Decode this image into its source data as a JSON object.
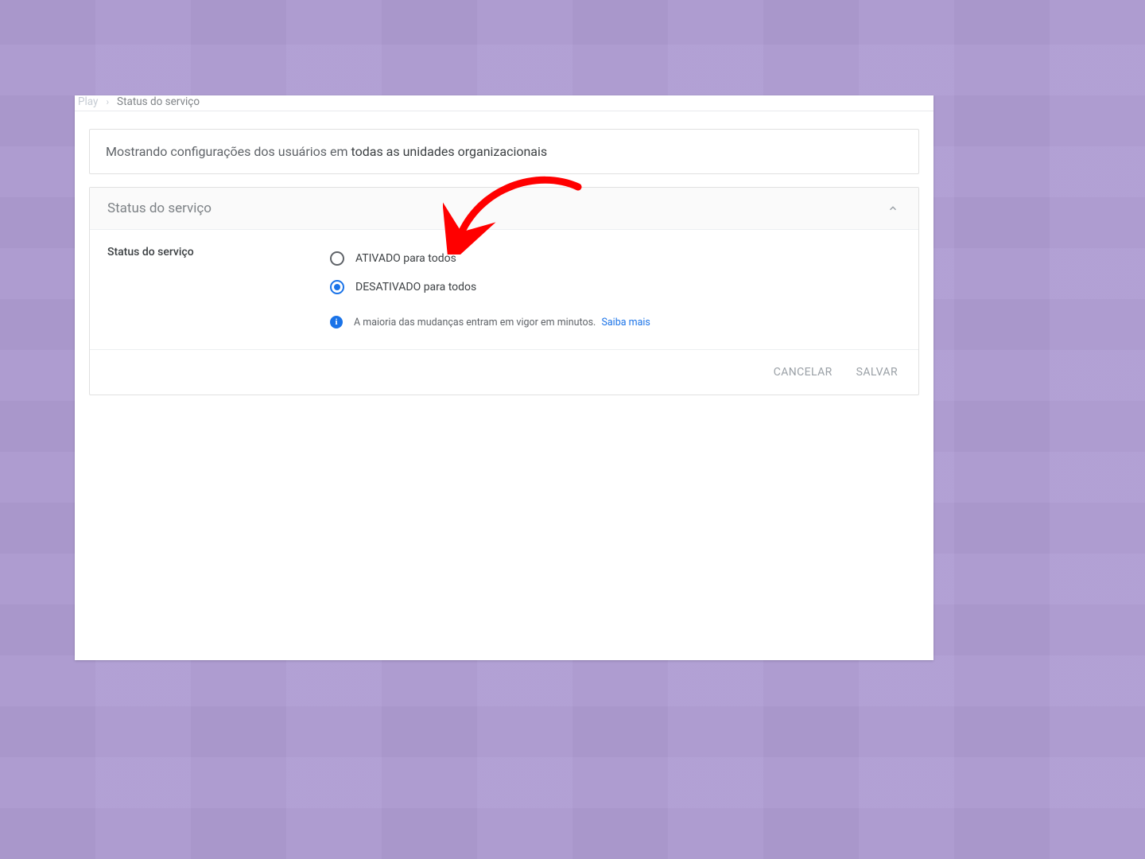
{
  "breadcrumb": {
    "prev": "Play",
    "current": "Status do serviço"
  },
  "banner": {
    "prefix": "Mostrando configurações dos usuários em ",
    "scope": "todas as unidades organizacionais"
  },
  "card": {
    "header_title": "Status do serviço",
    "section_label": "Status do serviço",
    "options": [
      {
        "label": "ATIVADO para todos",
        "selected": false
      },
      {
        "label": "DESATIVADO para todos",
        "selected": true
      }
    ],
    "note_text": "A maioria das mudanças entram em vigor em minutos.",
    "note_link": "Saiba mais",
    "buttons": {
      "cancel": "CANCELAR",
      "save": "SALVAR"
    }
  },
  "colors": {
    "accent": "#1a73e8",
    "annotation": "#ff0000",
    "background": "#af9dd3"
  }
}
